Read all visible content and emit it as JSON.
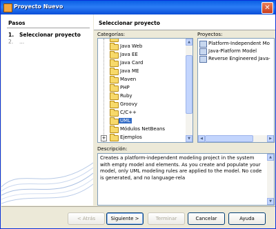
{
  "window": {
    "title": "Proyecto Nuevo",
    "close_glyph": "✕"
  },
  "steps": {
    "title": "Pasos",
    "items": [
      {
        "num": "1.",
        "label": "Seleccionar proyecto"
      },
      {
        "num": "2.",
        "label": "..."
      }
    ]
  },
  "content": {
    "title": "Seleccionar proyecto"
  },
  "categories": {
    "label": "Categorías:",
    "items": [
      {
        "label": "Java Web",
        "expander": ""
      },
      {
        "label": "Java EE",
        "expander": ""
      },
      {
        "label": "Java Card",
        "expander": ""
      },
      {
        "label": "Java ME",
        "expander": ""
      },
      {
        "label": "Maven",
        "expander": ""
      },
      {
        "label": "PHP",
        "expander": ""
      },
      {
        "label": "Ruby",
        "expander": ""
      },
      {
        "label": "Groovy",
        "expander": ""
      },
      {
        "label": "C/C++",
        "expander": ""
      },
      {
        "label": "UML",
        "expander": "",
        "selected": true
      },
      {
        "label": "Módulos NetBeans",
        "expander": ""
      },
      {
        "label": "Ejemplos",
        "expander": "+"
      }
    ]
  },
  "projects": {
    "label": "Proyectos:",
    "items": [
      {
        "label": "Platform-Independent Mo"
      },
      {
        "label": "Java-Platform Model"
      },
      {
        "label": "Reverse Engineered Java-"
      }
    ]
  },
  "description": {
    "label": "Descripción:",
    "text": "Creates a platform-independent modeling project in the system with empty model and elements. As you create and populate your model, only UML modeling rules are applied to the model. No code is generated, and no language-rela"
  },
  "buttons": {
    "back": "< Atrás",
    "next": "Siguiente >",
    "finish": "Terminar",
    "cancel": "Cancelar",
    "help": "Ayuda"
  },
  "colors": {
    "selection": "#316ac5",
    "titlebar": "#0a5fe4"
  }
}
